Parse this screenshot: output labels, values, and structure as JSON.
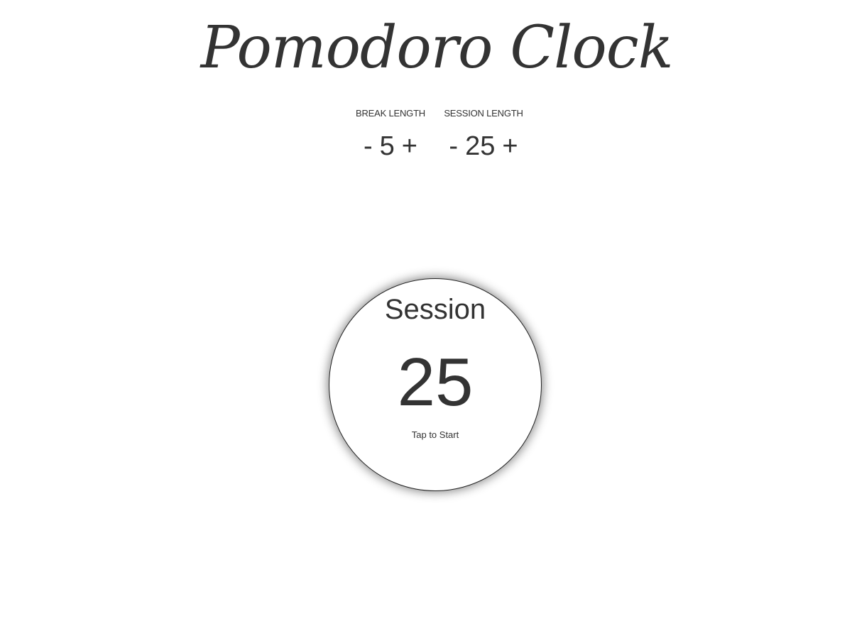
{
  "app": {
    "title": "Pomodoro Clock"
  },
  "controls": {
    "break": {
      "label": "BREAK LENGTH",
      "decrement": "-",
      "value": "5",
      "increment": "+"
    },
    "session": {
      "label": "SESSION LENGTH",
      "decrement": "-",
      "value": "25",
      "increment": "+"
    }
  },
  "clock": {
    "label": "Session",
    "time": "25",
    "hint": "Tap to Start"
  },
  "colors": {
    "text": "#333333",
    "background": "#ffffff",
    "clock_border": "#222222"
  }
}
